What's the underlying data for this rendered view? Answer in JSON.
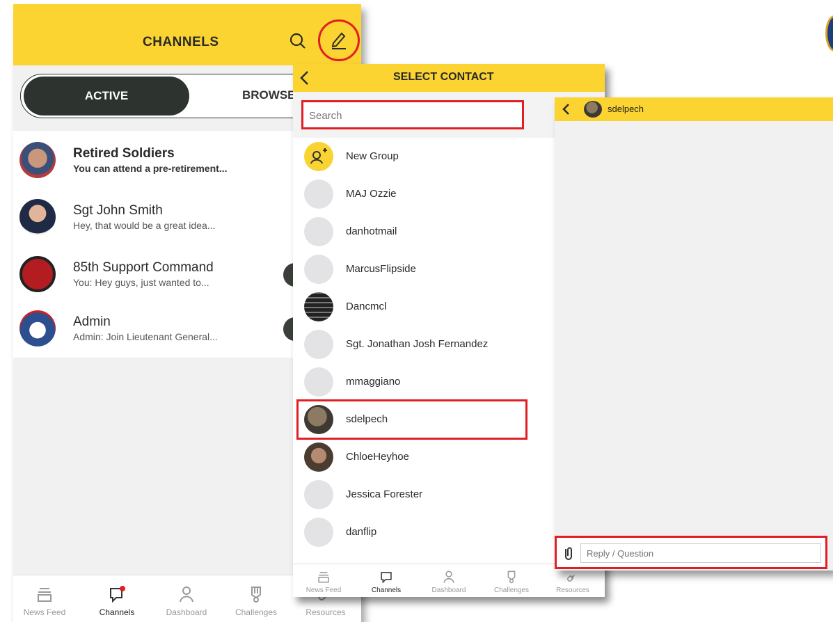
{
  "channels_screen": {
    "title": "CHANNELS",
    "tabs": {
      "active": "ACTIVE",
      "browse": "BROWSE"
    },
    "channels": [
      {
        "name": "Retired Soldiers",
        "preview": "You can attend a pre-retirement..."
      },
      {
        "name": "Sgt John Smith",
        "preview": "Hey, that would be a great idea..."
      },
      {
        "name": "85th Support Command",
        "preview": "You: Hey guys, just wanted to..."
      },
      {
        "name": "Admin",
        "preview": "Admin: Join Lieutenant General..."
      }
    ],
    "bottom_nav": [
      "News Feed",
      "Channels",
      "Dashboard",
      "Challenges",
      "Resources"
    ]
  },
  "select_contact_screen": {
    "title": "SELECT CONTACT",
    "search_placeholder": "Search",
    "contacts": [
      "New Group",
      "MAJ Ozzie",
      "danhotmail",
      "MarcusFlipside",
      "Dancmcl",
      "Sgt. Jonathan Josh Fernandez",
      "mmaggiano",
      "sdelpech",
      "ChloeHeyhoe",
      "Jessica Forester",
      "danflip"
    ],
    "bottom_nav": [
      "News Feed",
      "Channels",
      "Dashboard",
      "Challenges",
      "Resources"
    ]
  },
  "chat_screen": {
    "contact_name": "sdelpech",
    "reply_placeholder": "Reply / Question"
  },
  "colors": {
    "header_yellow": "#fbd431",
    "highlight_red": "#e01e24",
    "active_tab": "#2d342f"
  }
}
